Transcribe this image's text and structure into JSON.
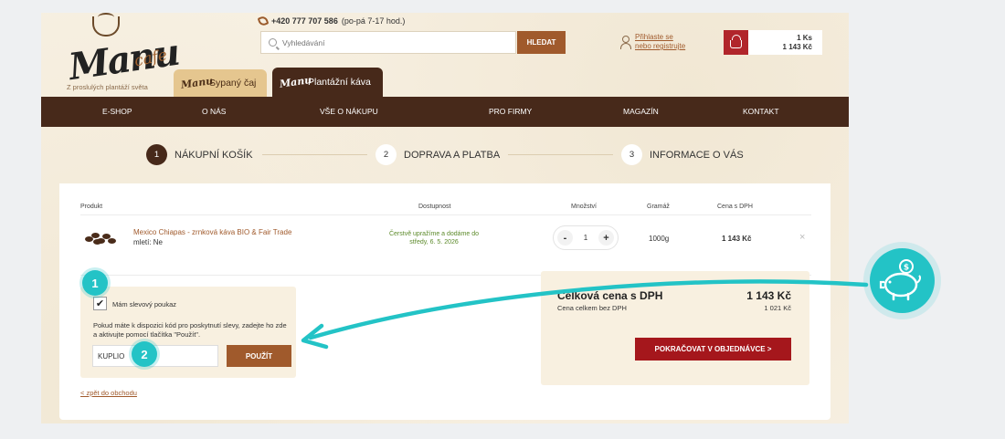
{
  "header": {
    "logo_word": "Manu",
    "logo_cafe": "cafe",
    "tagline": "Z proslulých plantáží světa",
    "phone": "+420 777 707 586",
    "phone_hours": "(po-pá 7-17 hod.)",
    "search_placeholder": "Vyhledávání",
    "search_button": "HLEDAT",
    "login_line1": "Přihlaste se",
    "login_line2": "nebo registrujte",
    "cart_count": "1 Ks",
    "cart_total": "1 143 Kč"
  },
  "tabs": [
    {
      "label": "Sypaný čaj"
    },
    {
      "label": "Plantážní káva"
    }
  ],
  "nav": [
    "E-SHOP",
    "O NÁS",
    "VŠE O NÁKUPU",
    "PRO FIRMY",
    "MAGAZÍN",
    "KONTAKT"
  ],
  "steps": [
    {
      "num": "1",
      "label": "NÁKUPNÍ KOŠÍK"
    },
    {
      "num": "2",
      "label": "DOPRAVA A PLATBA"
    },
    {
      "num": "3",
      "label": "INFORMACE O VÁS"
    }
  ],
  "table": {
    "headers": [
      "Produkt",
      "Dostupnost",
      "Množství",
      "Gramáž",
      "Cena s DPH"
    ],
    "row": {
      "name": "Mexico Chiapas - zrnková káva BIO & Fair Trade",
      "sub": "mletí: Ne",
      "avail_line1": "Čerstvě upražíme a dodáme do",
      "avail_line2": "středy, 6. 5. 2026",
      "qty": "1",
      "minus": "-",
      "plus": "+",
      "weight": "1000g",
      "price": "1 143 Kč",
      "remove": "×"
    }
  },
  "voucher": {
    "checkbox_mark": "✔",
    "label": "Mám slevový poukaz",
    "text": "Pokud máte k dispozici kód pro poskytnutí slevy, zadejte ho zde a aktivujte pomocí tlačítka \"Použít\".",
    "code": "KUPLIO",
    "apply": "POUŽÍT"
  },
  "back_link": "< zpět do obchodu",
  "summary": {
    "title": "Celková cena s DPH",
    "total": "1 143 Kč",
    "sub_label": "Cena celkem bez DPH",
    "sub_value": "1 021 Kč",
    "continue": "POKRAČOVAT V OBJEDNÁVCE  >"
  },
  "badges": [
    "1",
    "2"
  ],
  "colors": {
    "brand_brown": "#47291a",
    "accent": "#a05a2c",
    "cta_red": "#a5171c",
    "teal": "#23c3c6"
  },
  "icons": [
    "phone-icon",
    "search-icon",
    "user-icon",
    "basket-icon",
    "piggy-bank-icon",
    "coin-icon",
    "close-icon"
  ]
}
